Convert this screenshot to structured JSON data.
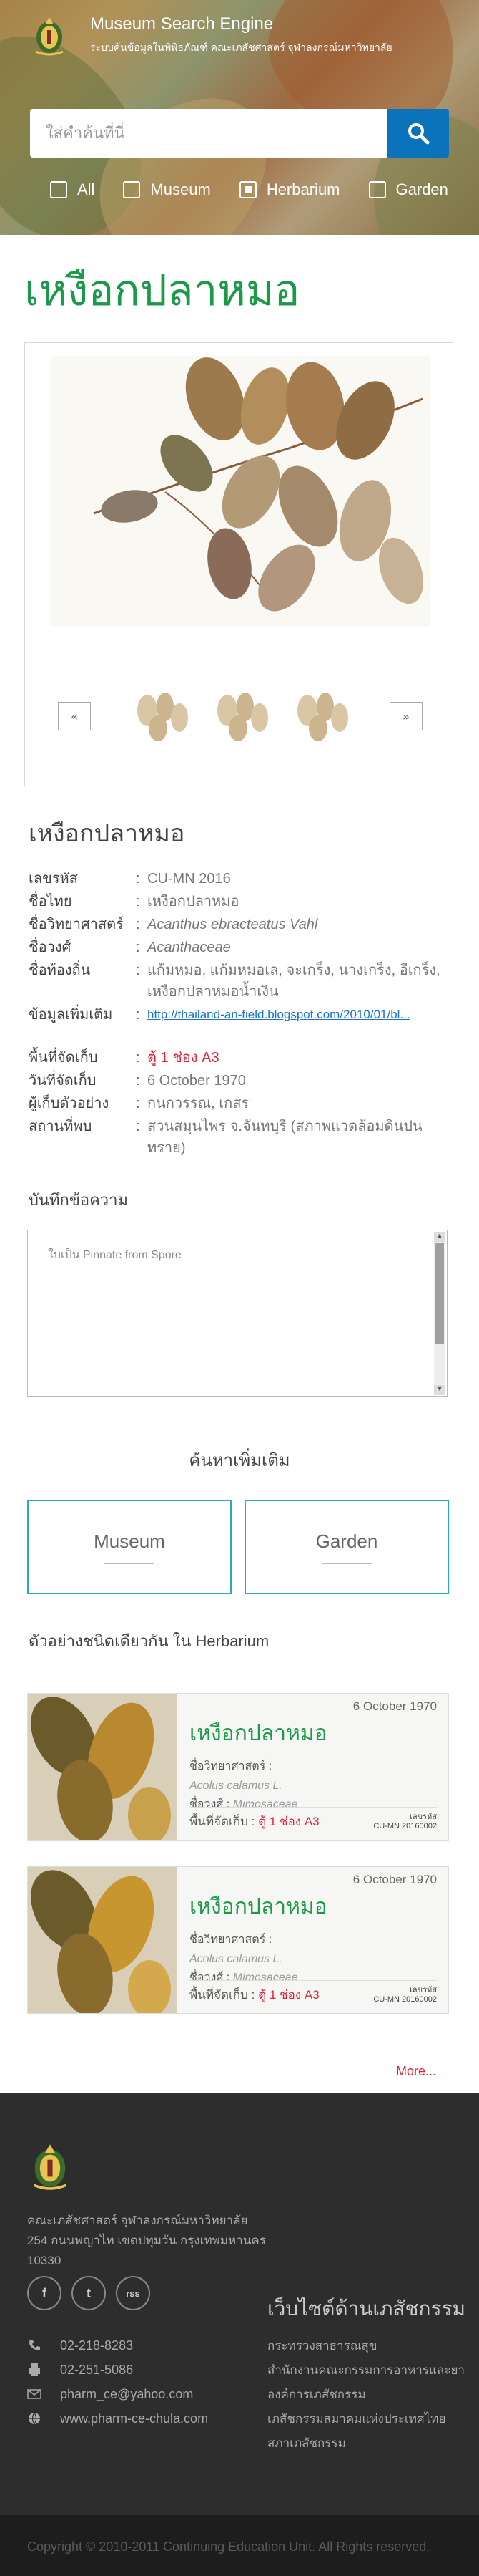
{
  "header": {
    "site_title": "Museum Search Engine",
    "site_subtitle": "ระบบค้นข้อมูลในพิพิธภัณฑ์ คณะเภสัชศาสตร์ จุฬาลงกรณ์มหาวิทยาลัย",
    "search_placeholder": "ใส่คำค้นที่นี่",
    "filters": [
      {
        "label": "All",
        "checked": false
      },
      {
        "label": "Museum",
        "checked": false
      },
      {
        "label": "Herbarium",
        "checked": true
      },
      {
        "label": "Garden",
        "checked": false
      }
    ]
  },
  "page": {
    "title": "เหงือกปลาหมอ"
  },
  "gallery": {
    "prev_label": "«",
    "next_label": "»",
    "thumb_count": 3
  },
  "details": {
    "heading": "เหงือกปลาหมอ",
    "fields": [
      {
        "key": "เลขรหัส",
        "value": "CU-MN 2016"
      },
      {
        "key": "ชื่อไทย",
        "value": "เหงือกปลาหมอ"
      },
      {
        "key": "ชื่อวิทยาศาสตร์",
        "value": "Acanthus ebracteatus Vahl"
      },
      {
        "key": "ชื่อวงศ์",
        "value": "Acanthaceae"
      },
      {
        "key": "ชื่อท้องถิ่น",
        "value": "แก้มหมอ, แก้มหมอเล, จะเกร็ง, นางเกร็ง, อีเกร็ง, เหงือกปลาหมอน้ำเงิน"
      },
      {
        "key": "ข้อมูลเพิ่มเติม",
        "value": "http://thailand-an-field.blogspot.com/2010/01/bl..."
      },
      {
        "key": "พื้นที่จัดเก็บ",
        "value": "ตู้ 1 ช่อง A3"
      },
      {
        "key": "วันที่จัดเก็บ",
        "value": "6 October 1970"
      },
      {
        "key": "ผู้เก็บตัวอย่าง",
        "value": "กนกวรรณ, เกสร"
      },
      {
        "key": "สถานที่พบ",
        "value": "สวนสมุนไพร จ.จันทบุรี (สภาพแวดล้อมดินปนทราย)"
      }
    ]
  },
  "notes": {
    "label": "บันทึกข้อความ",
    "text": "ใบเป็น Pinnate from Spore"
  },
  "more_search": {
    "title": "ค้นหาเพิ่มเติม",
    "buttons": [
      "Museum",
      "Garden"
    ]
  },
  "similar": {
    "heading": "ตัวอย่างชนิดเดียวกัน ใน Herbarium",
    "cards": [
      {
        "date": "6 October 1970",
        "title": "เหงือกปลาหมอ",
        "sci_label": "ชื่อวิทยาศาสตร์ :",
        "sci_value": "Acolus calamus L.",
        "family_label": "ชื่อวงศ์ :",
        "family_value": "Mimosaceae",
        "loc_label": "พื้นที่จัดเก็บ :",
        "loc_value": "ตู้ 1 ช่อง A3",
        "code_label": "เลขรหัส",
        "code": "CU-MN 20160002"
      },
      {
        "date": "6 October 1970",
        "title": "เหงือกปลาหมอ",
        "sci_label": "ชื่อวิทยาศาสตร์ :",
        "sci_value": "Acolus calamus L.",
        "family_label": "ชื่อวงศ์ :",
        "family_value": "Mimosaceae",
        "loc_label": "พื้นที่จัดเก็บ :",
        "loc_value": "ตู้ 1 ช่อง A3",
        "code_label": "เลขรหัส",
        "code": "CU-MN 20160002"
      }
    ],
    "more_label": "More..."
  },
  "footer": {
    "address_lines": [
      "คณะเภสัชศาสตร์ จุฬาลงกรณ์มหาวิทยาลัย",
      "254 ถนนพญาไท เขตปทุมวัน กรุงเทพมหานคร",
      "10330"
    ],
    "social": [
      "f",
      "t",
      "rss"
    ],
    "contacts": [
      {
        "icon": "phone-icon",
        "text": "02-218-8283"
      },
      {
        "icon": "fax-icon",
        "text": "02-251-5086"
      },
      {
        "icon": "mail-icon",
        "text": "pharm_ce@yahoo.com"
      },
      {
        "icon": "globe-icon",
        "text": "www.pharm-ce-chula.com"
      }
    ],
    "links_heading": "เว็บไซต์ด้านเภสัชกรรม",
    "links": [
      "กระทรวงสาธารณสุข",
      "สำนักงานคณะกรรมการอาหารและยา",
      "องค์การเภสัชกรรม",
      "เภสัชกรรมสมาคมแห่งประเทศไทย",
      "สภาเภสัชกรรม"
    ],
    "copyright": "Copyright © 2010-2011 Continuing Education Unit. All Rights reserved."
  },
  "colors": {
    "accent_green": "#1b9a4a",
    "search_blue": "#0b73bc",
    "red": "#e0233a",
    "footer_bg": "#2d2d2d"
  }
}
